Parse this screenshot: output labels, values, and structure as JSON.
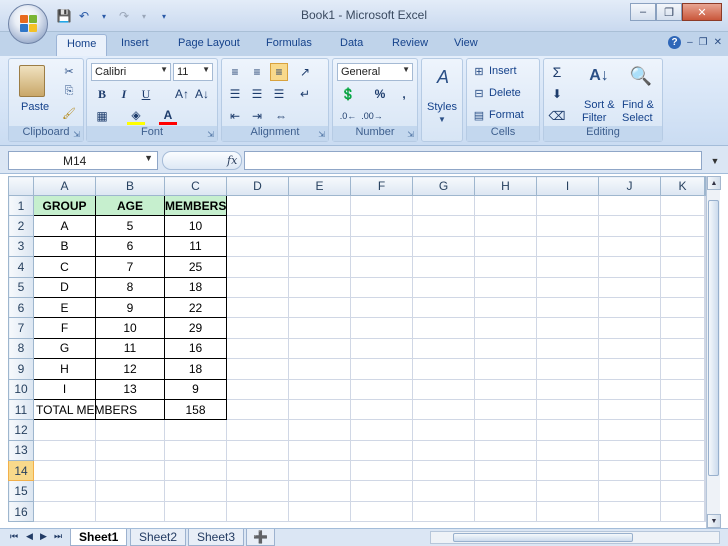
{
  "titlebar": {
    "title": "Book1 - Microsoft Excel"
  },
  "tabs": [
    "Home",
    "Insert",
    "Page Layout",
    "Formulas",
    "Data",
    "Review",
    "View"
  ],
  "ribbon": {
    "clipboard": {
      "name": "Clipboard",
      "paste": "Paste"
    },
    "font": {
      "name": "Font",
      "family": "Calibri",
      "size": "11",
      "bold": "B",
      "italic": "I",
      "underline": "U"
    },
    "alignment": {
      "name": "Alignment"
    },
    "number": {
      "name": "Number",
      "format": "General",
      "percent": "%",
      "comma": ","
    },
    "styles": {
      "name": "Styles"
    },
    "cells": {
      "name": "Cells",
      "insert": "Insert",
      "delete": "Delete",
      "format": "Format"
    },
    "editing": {
      "name": "Editing",
      "sort": "Sort &",
      "filter": "Filter",
      "find": "Find &",
      "select": "Select"
    }
  },
  "formula_bar": {
    "name_box": "M14",
    "fx": "fx",
    "formula": ""
  },
  "columns": [
    "A",
    "B",
    "C",
    "D",
    "E",
    "F",
    "G",
    "H",
    "I",
    "J",
    "K"
  ],
  "rows": [
    [
      "GROUP",
      "AGE",
      "MEMBERS"
    ],
    [
      "A",
      "5",
      "10"
    ],
    [
      "B",
      "6",
      "11"
    ],
    [
      "C",
      "7",
      "25"
    ],
    [
      "D",
      "8",
      "18"
    ],
    [
      "E",
      "9",
      "22"
    ],
    [
      "F",
      "10",
      "29"
    ],
    [
      "G",
      "11",
      "16"
    ],
    [
      "H",
      "12",
      "18"
    ],
    [
      "I",
      "13",
      "9"
    ],
    [
      "TOTAL MEMBERS",
      "",
      "158"
    ],
    [
      "",
      "",
      ""
    ],
    [
      "",
      "",
      ""
    ],
    [
      "",
      "",
      ""
    ],
    [
      "",
      "",
      ""
    ],
    [
      "",
      "",
      ""
    ]
  ],
  "row_numbers": [
    "1",
    "2",
    "3",
    "4",
    "5",
    "6",
    "7",
    "8",
    "9",
    "10",
    "11",
    "12",
    "13",
    "14",
    "15",
    "16"
  ],
  "selected_row": "14",
  "sheets": [
    "Sheet1",
    "Sheet2",
    "Sheet3"
  ],
  "active_sheet": "Sheet1",
  "colors": {
    "header_fill": "#c6efce",
    "selected_row_header": "#f8d98b",
    "ribbon": "#dbe6f4"
  }
}
